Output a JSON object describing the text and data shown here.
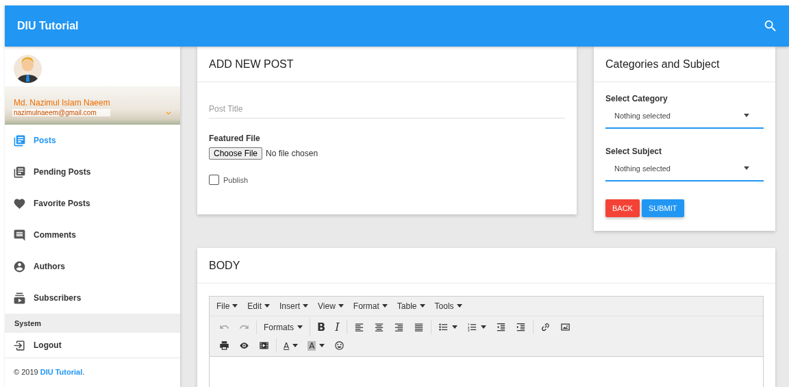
{
  "header": {
    "title": "DIU Tutorial"
  },
  "sidebar": {
    "user": {
      "name": "Md. Nazimul Islam Naeem",
      "email": "nazimulnaeem@gmail.com"
    },
    "items": [
      {
        "label": "Posts",
        "selected": true
      },
      {
        "label": "Pending Posts",
        "selected": false
      },
      {
        "label": "Favorite Posts",
        "selected": false
      },
      {
        "label": "Comments",
        "selected": false
      },
      {
        "label": "Authors",
        "selected": false
      },
      {
        "label": "Subscribers",
        "selected": false
      }
    ],
    "section": "System",
    "logout": "Logout",
    "footer": {
      "prefix": "© 2019",
      "link": "DIU Tutorial",
      "suffix": "."
    }
  },
  "post_card": {
    "title": "ADD NEW POST",
    "title_placeholder": "Post Title",
    "file_label": "Featured File",
    "file_button": "Choose File",
    "file_status": "No file chosen",
    "publish": {
      "label": "Publish",
      "checked": false
    }
  },
  "categories_card": {
    "title": "Categories and Subject",
    "fields": [
      {
        "label": "Select Category",
        "value": "Nothing selected"
      },
      {
        "label": "Select Subject",
        "value": "Nothing selected"
      }
    ],
    "buttons": [
      {
        "label": "BACK",
        "kind": "danger"
      },
      {
        "label": "SUBMIT",
        "kind": "primary"
      }
    ]
  },
  "body_card": {
    "title": "BODY",
    "editor": {
      "menus": [
        "File",
        "Edit",
        "Insert",
        "View",
        "Format",
        "Table",
        "Tools"
      ],
      "toolbar": [
        [
          [
            {
              "kind": "undo",
              "disabled": true
            },
            {
              "kind": "redo",
              "disabled": true
            }
          ],
          [
            {
              "kind": "menu",
              "label": "Formats",
              "disabled": false
            }
          ],
          [
            {
              "kind": "bold",
              "label": "B",
              "disabled": false
            },
            {
              "kind": "italic",
              "label": "I",
              "disabled": false
            }
          ],
          [
            {
              "kind": "align-left",
              "disabled": false
            },
            {
              "kind": "align-center",
              "disabled": false
            },
            {
              "kind": "align-right",
              "disabled": false
            },
            {
              "kind": "justify",
              "disabled": false
            }
          ],
          [
            {
              "kind": "bullet-list",
              "disabled": false
            },
            {
              "kind": "number-list",
              "disabled": false
            },
            {
              "kind": "outdent",
              "disabled": false
            },
            {
              "kind": "indent",
              "disabled": false
            }
          ],
          [
            {
              "kind": "link",
              "disabled": false
            },
            {
              "kind": "image",
              "disabled": false
            }
          ]
        ],
        [
          [
            {
              "kind": "print",
              "disabled": false
            },
            {
              "kind": "preview",
              "disabled": false
            },
            {
              "kind": "media",
              "disabled": false
            }
          ],
          [
            {
              "kind": "text-color",
              "label": "A",
              "disabled": false
            },
            {
              "kind": "bg-color",
              "label": "A",
              "disabled": false
            },
            {
              "kind": "emoji",
              "disabled": false
            }
          ]
        ]
      ]
    }
  }
}
